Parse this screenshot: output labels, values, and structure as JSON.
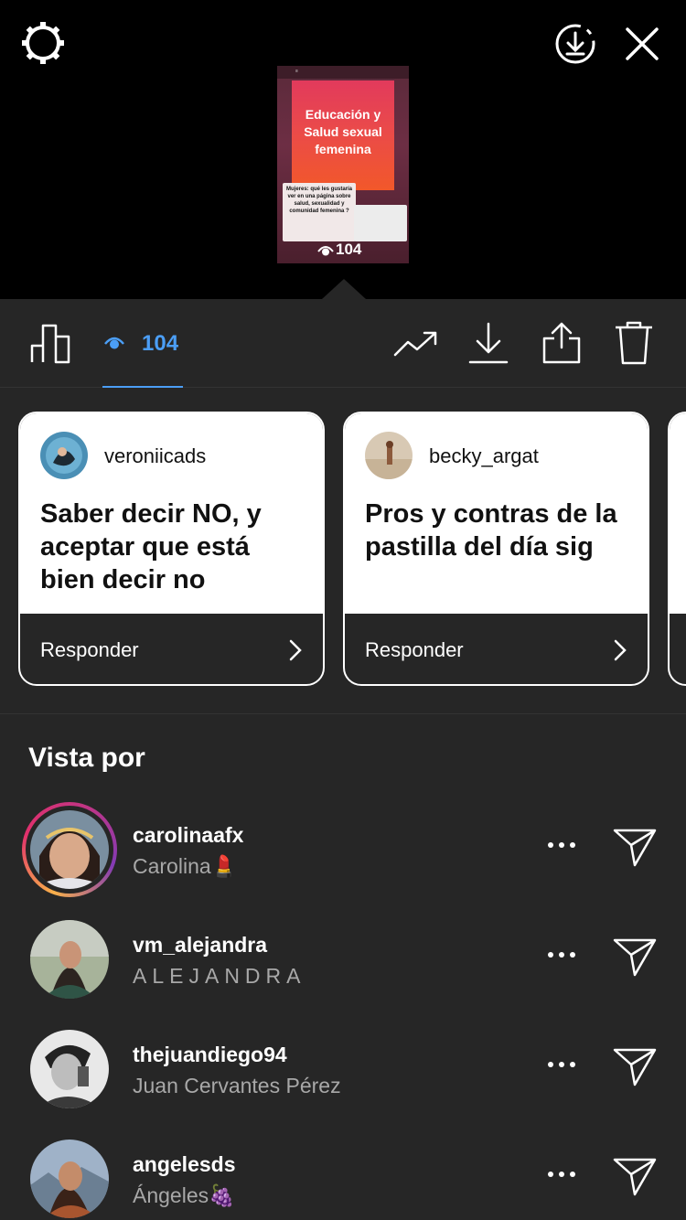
{
  "header": {
    "settings_icon": "gear-icon",
    "save_icon": "download-circle-icon",
    "close_icon": "close-icon"
  },
  "story_preview": {
    "title": "Educación y Salud sexual femenina",
    "question_sticker": "Mujeres: qué les gustaría ver en una página sobre salud, sexualidad y comunidad femenina ?",
    "view_count": "104"
  },
  "toolbar": {
    "views": "104",
    "accent": "#4b9ef5",
    "icons": [
      "insights-icon",
      "eye-icon",
      "trending-icon",
      "download-icon",
      "share-icon",
      "trash-icon"
    ]
  },
  "question_cards": [
    {
      "username": "veroniicads",
      "question": "Saber decir NO, y aceptar que está bien decir no",
      "reply_label": "Responder"
    },
    {
      "username": "becky_argat",
      "question": "Pros y contras de la pastilla del día sig",
      "reply_label": "Responder"
    }
  ],
  "viewers_section": {
    "title": "Vista por",
    "viewers": [
      {
        "username": "carolinaafx",
        "name": "Carolina💄",
        "has_story_ring": true
      },
      {
        "username": "vm_alejandra",
        "name": "ALEJANDRA",
        "has_story_ring": false
      },
      {
        "username": "thejuandiego94",
        "name": "Juan Cervantes Pérez",
        "has_story_ring": false
      },
      {
        "username": "angelesds",
        "name": "Ángeles🍇",
        "has_story_ring": false
      }
    ]
  }
}
